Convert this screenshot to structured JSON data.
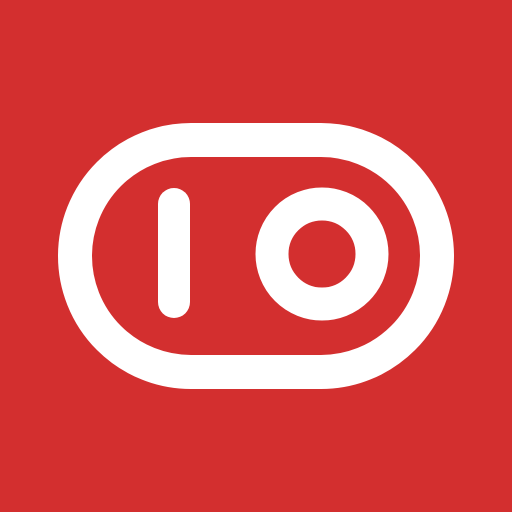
{
  "icon": {
    "name": "toggle-switch-icon",
    "colors": {
      "background": "#D32F2F",
      "foreground": "#FFFFFF"
    }
  }
}
